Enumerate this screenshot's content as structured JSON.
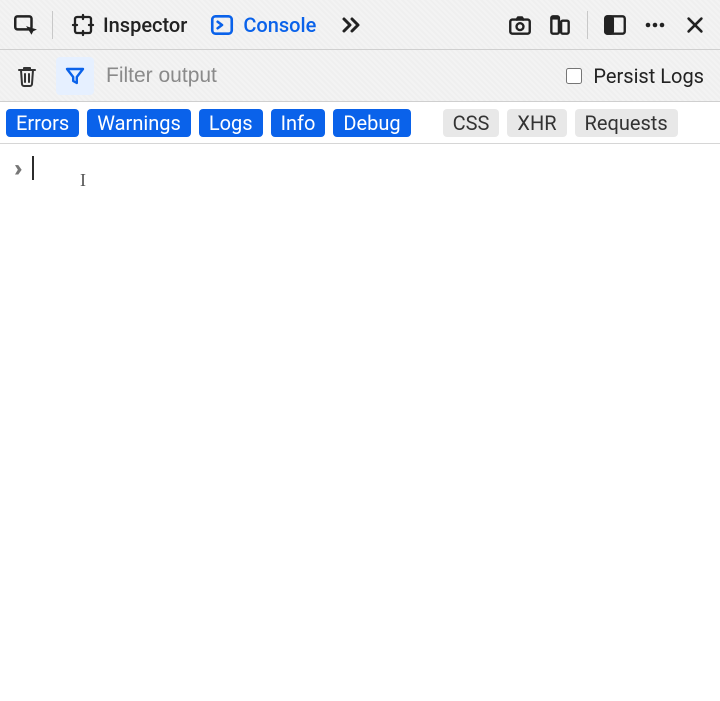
{
  "tabs": {
    "inspector": "Inspector",
    "console": "Console"
  },
  "filter": {
    "placeholder": "Filter output",
    "persist_label": "Persist Logs",
    "persist_checked": false
  },
  "categories": {
    "errors": "Errors",
    "warnings": "Warnings",
    "logs": "Logs",
    "info": "Info",
    "debug": "Debug",
    "css": "CSS",
    "xhr": "XHR",
    "requests": "Requests"
  },
  "console": {
    "input_value": ""
  }
}
